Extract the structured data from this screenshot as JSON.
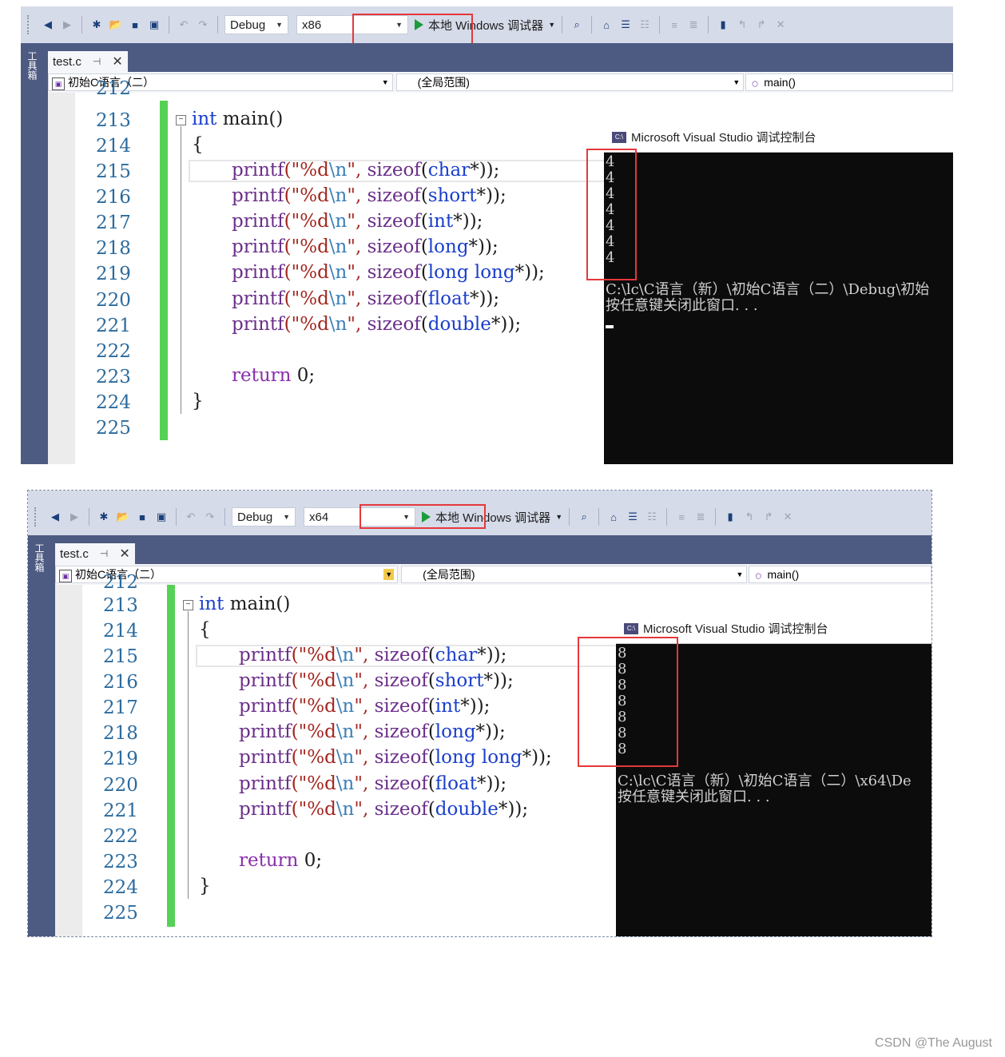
{
  "toolbar": {
    "config": "Debug",
    "run_label": "本地 Windows 调试器"
  },
  "tab": {
    "file": "test.c"
  },
  "toolbox_label": "工具箱",
  "nav": {
    "project": "初始C语言（二）",
    "scope": "(全局范围)",
    "func": "main()"
  },
  "line_numbers": [
    "212",
    "213",
    "214",
    "215",
    "216",
    "217",
    "218",
    "219",
    "220",
    "221",
    "222",
    "223",
    "224",
    "225"
  ],
  "code": {
    "l213": {
      "kw": "int",
      "rest": " main()"
    },
    "l214": "{",
    "printf_fn": "printf",
    "str_open": "(\"%d",
    "str_esc": "\\n",
    "str_close": "\",",
    "sizeof": "sizeof",
    "types": [
      "char",
      "short",
      "int",
      "long",
      "long long",
      "float",
      "double"
    ],
    "ptr_close": "*));",
    "return_kw": "return",
    "return_val": " 0;",
    "l224": "}"
  },
  "panels": [
    {
      "platform": "x86",
      "console_title": "Microsoft Visual Studio 调试控制台",
      "outputs": [
        "4",
        "4",
        "4",
        "4",
        "4",
        "4",
        "4"
      ],
      "path": "C:\\lc\\C语言（新）\\初始C语言（二）\\Debug\\初始",
      "press_key": "按任意键关闭此窗口. . ."
    },
    {
      "platform": "x64",
      "console_title": "Microsoft Visual Studio 调试控制台",
      "outputs": [
        "8",
        "8",
        "8",
        "8",
        "8",
        "8",
        "8"
      ],
      "path": "C:\\lc\\C语言（新）\\初始C语言（二）\\x64\\De",
      "press_key": "按任意键关闭此窗口. . ."
    }
  ],
  "watermark": "CSDN @The   August"
}
